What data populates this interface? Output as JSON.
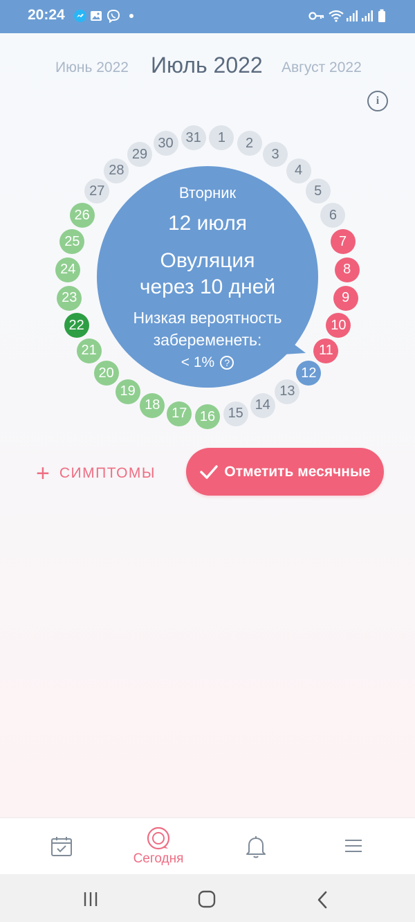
{
  "status": {
    "time": "20:24",
    "left_icons": [
      "messenger-icon",
      "gallery-icon",
      "viber-icon",
      "notification-dot-icon"
    ],
    "right_icons": [
      "key-icon",
      "wifi-icon",
      "signal-icon",
      "signal-icon",
      "battery-icon"
    ]
  },
  "months": {
    "prev": "Июнь 2022",
    "current": "Июль 2022",
    "next": "Август 2022"
  },
  "info": {
    "label": "i"
  },
  "colors": {
    "past": "#dfe4ea",
    "period": "#f0607a",
    "today": "#6a9bd3",
    "fertile": "#8fce8f",
    "ovulation": "#2e9e44",
    "accent": "#f16179"
  },
  "days": [
    {
      "n": "1",
      "state": "past"
    },
    {
      "n": "2",
      "state": "past"
    },
    {
      "n": "3",
      "state": "past"
    },
    {
      "n": "4",
      "state": "past"
    },
    {
      "n": "5",
      "state": "past"
    },
    {
      "n": "6",
      "state": "past"
    },
    {
      "n": "7",
      "state": "period"
    },
    {
      "n": "8",
      "state": "period"
    },
    {
      "n": "9",
      "state": "period"
    },
    {
      "n": "10",
      "state": "period"
    },
    {
      "n": "11",
      "state": "period"
    },
    {
      "n": "12",
      "state": "today"
    },
    {
      "n": "13",
      "state": "past"
    },
    {
      "n": "14",
      "state": "past"
    },
    {
      "n": "15",
      "state": "past"
    },
    {
      "n": "16",
      "state": "fertile"
    },
    {
      "n": "17",
      "state": "fertile"
    },
    {
      "n": "18",
      "state": "fertile"
    },
    {
      "n": "19",
      "state": "fertile"
    },
    {
      "n": "20",
      "state": "fertile"
    },
    {
      "n": "21",
      "state": "fertile"
    },
    {
      "n": "22",
      "state": "ovul"
    },
    {
      "n": "23",
      "state": "fertile"
    },
    {
      "n": "24",
      "state": "fertile"
    },
    {
      "n": "25",
      "state": "fertile"
    },
    {
      "n": "26",
      "state": "fertile"
    },
    {
      "n": "27",
      "state": "past"
    },
    {
      "n": "28",
      "state": "past"
    },
    {
      "n": "29",
      "state": "past"
    },
    {
      "n": "30",
      "state": "past"
    },
    {
      "n": "31",
      "state": "past"
    }
  ],
  "bubble": {
    "weekday": "Вторник",
    "date": "12 июля",
    "ovulation_line1": "Овуляция",
    "ovulation_line2": "через 10 дней",
    "prob_line1": "Низкая вероятность",
    "prob_line2": "забеременеть:",
    "prob_value": "< 1%",
    "help_label": "?"
  },
  "actions": {
    "symptoms_plus": "+",
    "symptoms_label": "СИМПТОМЫ",
    "mark_period_label": "Отметить месячные"
  },
  "nav": {
    "items": [
      {
        "icon": "calendar-check-icon",
        "label": ""
      },
      {
        "icon": "target-circle-icon",
        "label": "Сегодня"
      },
      {
        "icon": "bell-icon",
        "label": ""
      },
      {
        "icon": "menu-icon",
        "label": ""
      }
    ]
  },
  "system_nav": [
    "recent-apps-icon",
    "home-icon",
    "back-icon"
  ]
}
